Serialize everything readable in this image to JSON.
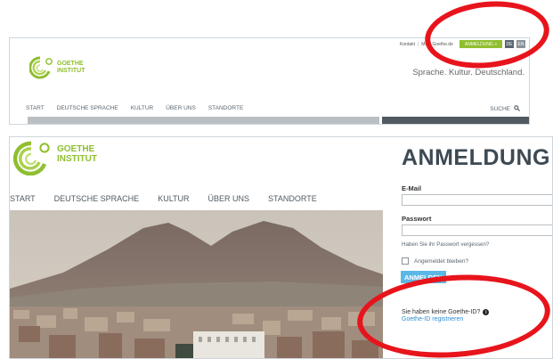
{
  "top": {
    "util_links": [
      "Kontakt",
      "Mein Goethe.de"
    ],
    "login_button": "ANMELDUNG »",
    "languages": [
      "DE",
      "EN"
    ],
    "logo_lines": [
      "GOETHE",
      "INSTITUT"
    ],
    "tagline": "Sprache. Kultur. Deutschland.",
    "nav": [
      "START",
      "DEUTSCHE SPRACHE",
      "KULTUR",
      "ÜBER UNS",
      "STANDORTE"
    ],
    "search_label": "SUCHE"
  },
  "bottom": {
    "logo_lines": [
      "GOETHE",
      "INSTITUT"
    ],
    "nav": [
      "START",
      "DEUTSCHE SPRACHE",
      "KULTUR",
      "ÜBER UNS",
      "STANDORTE"
    ],
    "login": {
      "title": "ANMELDUNG",
      "email_label": "E-Mail",
      "email_value": "",
      "password_label": "Passwort",
      "password_value": "",
      "forgot_password": "Haben Sie ihr Passwort vergessen?",
      "remember_me": "Angemeldet bleiben?",
      "submit": "ANMELDEN",
      "no_account": "Sie haben keine Goethe-ID?",
      "register_link": "Goethe-ID registrieren"
    }
  },
  "colors": {
    "brand_green": "#8fbf2f",
    "annotation_red": "#e8141c",
    "button_blue": "#5bb8e6",
    "link_blue": "#2f8cd0",
    "text_dark": "#3d4a54"
  },
  "icons": [
    "goethe-logo-icon",
    "search-icon",
    "info-icon"
  ]
}
